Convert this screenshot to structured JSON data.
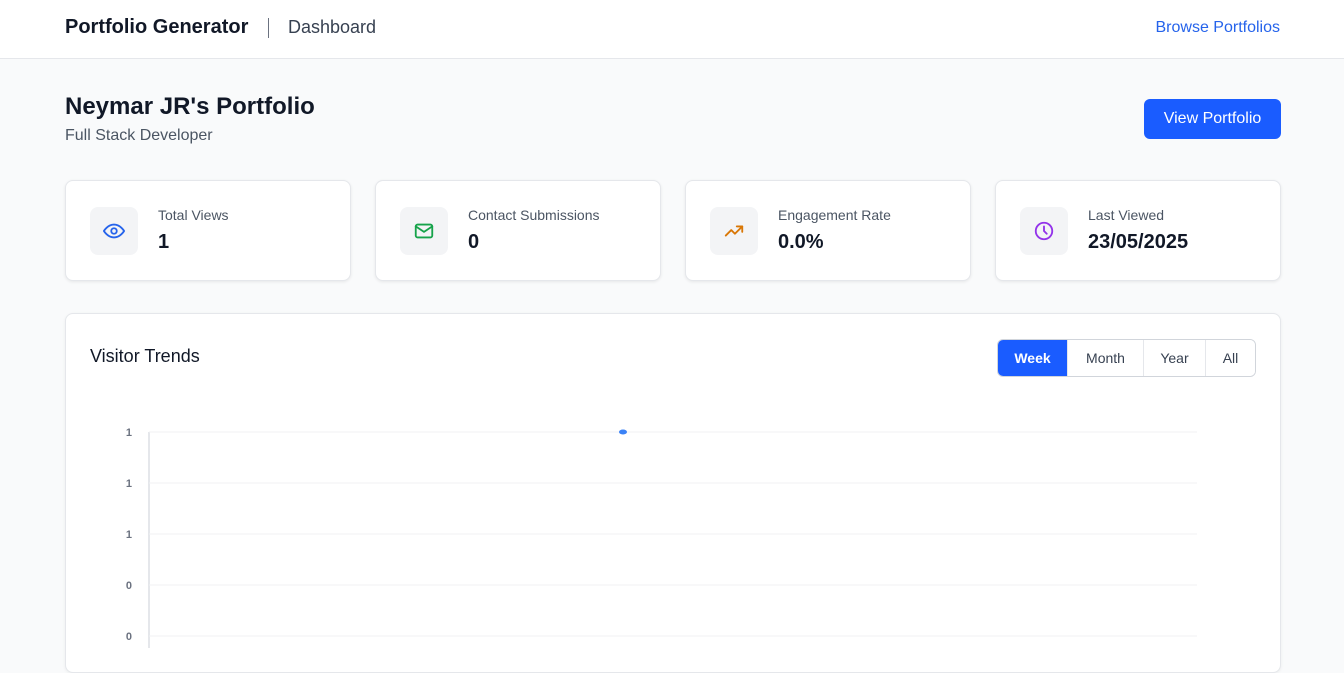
{
  "header": {
    "brand": "Portfolio Generator",
    "crumb": "Dashboard",
    "browse_label": "Browse Portfolios"
  },
  "portfolio": {
    "title": "Neymar JR's Portfolio",
    "subtitle": "Full Stack Developer",
    "view_button": "View Portfolio"
  },
  "stats": [
    {
      "label": "Total Views",
      "value": "1",
      "icon": "eye-icon",
      "color": "#2563eb"
    },
    {
      "label": "Contact Submissions",
      "value": "0",
      "icon": "mail-icon",
      "color": "#16a34a"
    },
    {
      "label": "Engagement Rate",
      "value": "0.0%",
      "icon": "trending-up-icon",
      "color": "#d97706"
    },
    {
      "label": "Last Viewed",
      "value": "23/05/2025",
      "icon": "clock-icon",
      "color": "#9333ea"
    }
  ],
  "visitor_trends": {
    "title": "Visitor Trends",
    "ranges": [
      "Week",
      "Month",
      "Year",
      "All"
    ],
    "active_range": "Week"
  },
  "chart_data": {
    "type": "line",
    "title": "",
    "xlabel": "",
    "ylabel": "",
    "y_tick_labels": [
      "1",
      "1",
      "1",
      "0",
      "0"
    ],
    "ylim": [
      0,
      1
    ],
    "grid": true,
    "series": [
      {
        "values": [
          1
        ],
        "color": "#3b82f6"
      }
    ]
  }
}
